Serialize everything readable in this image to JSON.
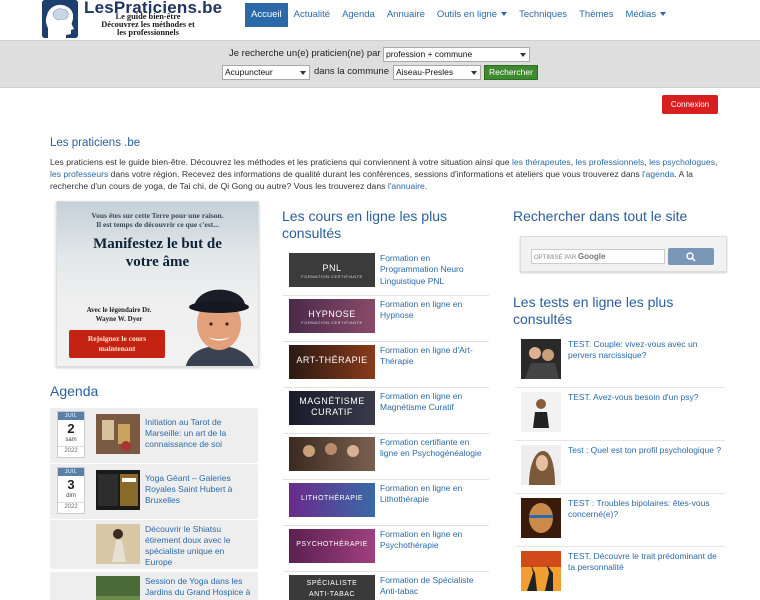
{
  "logo": {
    "title": "LesPraticiens.be",
    "subtitle_lines": [
      "Le guide bien-être",
      "Découvrez les méthodes et",
      "les professionnels"
    ]
  },
  "nav": {
    "items": [
      {
        "label": "Accueil",
        "active": true
      },
      {
        "label": "Actualité"
      },
      {
        "label": "Agenda"
      },
      {
        "label": "Annuaire"
      },
      {
        "label": "Outils en ligne",
        "dropdown": true
      },
      {
        "label": "Techniques"
      },
      {
        "label": "Thèmes"
      },
      {
        "label": "Médias",
        "dropdown": true
      }
    ]
  },
  "search": {
    "label1": "Je recherche un(e) praticien(ne) par",
    "mode_value": "profession + commune",
    "profession_value": "Acupuncteur",
    "label2": "dans la commune",
    "commune_value": "Aiseau-Presles",
    "button": "Rechercher"
  },
  "connexion": "Connexion",
  "intro": {
    "title": "Les praticiens .be",
    "p1": "Les praticiens est le guide bien-être. Découvrez les méthodes et les praticiens qui conviennent à votre situation ainsi que ",
    "link1": "les thérapeutes",
    "sep1": ", ",
    "link2": "les professionnels",
    "sep2": ", ",
    "link3": "les psychologues",
    "sep3": ", ",
    "link4": "les professeurs",
    "p2": " dans votre région. Recevez des informations de qualité durant les conférences, sessions d'informations et ateliers que vous trouverez dans ",
    "link5": "l'agenda",
    "p3": ". A la recherche d'un cours de yoga, de Tai chi, de Qi Gong ou autre? Vous les trouverez dans ",
    "link6": "l'annuaire",
    "p4": "."
  },
  "promo": {
    "line1": "Vous êtes sur cette Terre pour une raison.",
    "line2": "Il est temps de découvrir ce que c'est...",
    "big1": "Manifestez le but de",
    "big2": "votre âme",
    "with1": "Avec le légendaire Dr.",
    "with2": "Wayne W. Dyer",
    "cta1": "Rejoignez le cours",
    "cta2": "maintenant"
  },
  "agenda": {
    "title": "Agenda",
    "dates": [
      {
        "month": "JUIL",
        "day": "2",
        "dow": "sam",
        "year": "2022"
      },
      {
        "month": "JUIL",
        "day": "3",
        "dow": "dim",
        "year": "2022"
      }
    ],
    "events": [
      {
        "text": "Initiation au Tarot de Marseille: un art de la connaissance de soi"
      },
      {
        "text": "Yoga Géant – Galeries Royales Saint Hubert à Bruxelles"
      },
      {
        "text": "Découvrir le Shiatsu étirement doux avec le spécialiste unique en Europe"
      },
      {
        "text": "Session de Yoga dans les Jardins du Grand Hospice à"
      }
    ]
  },
  "courses": {
    "title_line1": "Les cours en ligne les plus",
    "title_line2": "consultés",
    "items": [
      {
        "thumb": "PNL",
        "thumb_sub": "FORMATION CERTIFIANTE",
        "color": "#3b3b3b",
        "text": "Formation en Programmation Neuro Linguistique PNL"
      },
      {
        "thumb": "HYPNOSE",
        "thumb_sub": "FORMATION CERTIFIANTE",
        "color": "#6b3a5a",
        "text": "Formation en ligne en Hypnose"
      },
      {
        "thumb": "ART-THÉRAPIE",
        "thumb_sub": "",
        "color": "#5a2a1a",
        "text": "Formation en ligne d'Art-Thérapie"
      },
      {
        "thumb": "MAGNÉTISME",
        "thumb2": "CURATIF",
        "thumb_sub": "",
        "color": "#2a2a3a",
        "text": "Formation en ligne en Magnétisme Curatif"
      },
      {
        "thumb": "",
        "thumb_sub": "",
        "color": "#4a3a30",
        "text": "Formation certifiante en ligne en Psychogénéalogie"
      },
      {
        "thumb": "LITHOTHÉRAPIE",
        "thumb_sub": "",
        "color": "#4a2a5a",
        "text": "Formation en ligne en Lithothérapie"
      },
      {
        "thumb": "PSYCHOTHÉRAPIE",
        "thumb_sub": "",
        "color": "#6a3060",
        "text": "Formation en ligne en Psychothérapie"
      },
      {
        "thumb": "SPÉCIALISTE",
        "thumb2": "ANTI-TABAC",
        "thumb_sub": "",
        "color": "#3a3a3a",
        "text": "Formation de Spécialiste Anti-tabac"
      }
    ]
  },
  "site_search": {
    "title": "Rechercher dans tout le site",
    "placeholder_prefix": "OPTIMISÉ PAR",
    "placeholder_brand": "Google"
  },
  "tests": {
    "title_line1": "Les tests en ligne les plus",
    "title_line2": "consultés",
    "items": [
      {
        "text": "TEST. Couple: vivez-vous avec un pervers narcissique?"
      },
      {
        "text": "TEST. Avez-vous besoin d'un psy?"
      },
      {
        "text": "Test : Quel est ton profil psychologique ?"
      },
      {
        "text": "TEST : Troubles bipolaires: êtes-vous concerné(e)?"
      },
      {
        "text": "TEST. Découvre le trait prédominant de ta personnalité"
      }
    ]
  },
  "colors": {
    "brand_blue": "#2a6aa8",
    "nav_active_bg": "#2a6aa8",
    "connexion_red": "#d81e1e",
    "search_green": "#3e8a2e"
  }
}
